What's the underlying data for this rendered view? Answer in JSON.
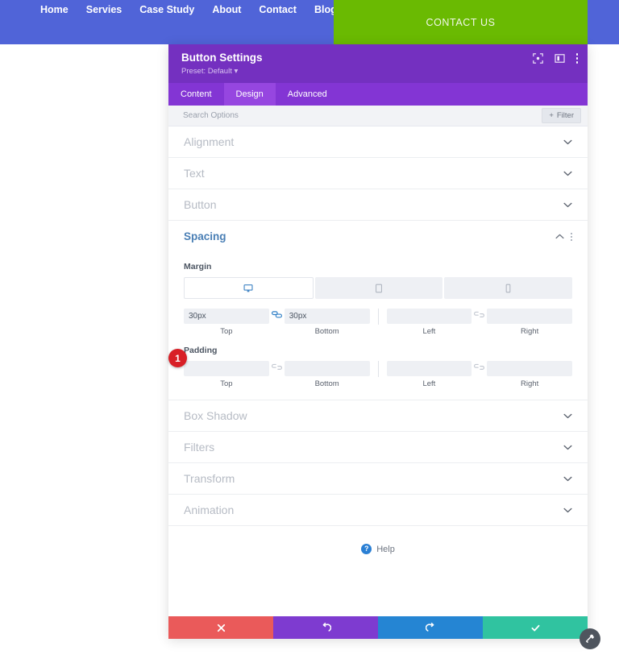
{
  "site_header": {
    "background_color": "#5064d8",
    "nav_items": [
      {
        "label": "Home"
      },
      {
        "label": "Servies"
      },
      {
        "label": "Case Study"
      },
      {
        "label": "About"
      },
      {
        "label": "Contact"
      },
      {
        "label": "Blog"
      }
    ],
    "cta": {
      "label": "CONTACT US",
      "background_color": "#6aba02"
    }
  },
  "modal": {
    "title": "Button Settings",
    "preset": "Preset: Default ▾",
    "header_color": "#7430c0",
    "icons": {
      "expand": "expand-icon",
      "layout": "layout-panel-icon",
      "menu": "kebab-menu-icon"
    },
    "tabs": [
      {
        "label": "Content",
        "active": false
      },
      {
        "label": "Design",
        "active": true
      },
      {
        "label": "Advanced",
        "active": false
      }
    ],
    "search": {
      "placeholder": "Search Options",
      "value": ""
    },
    "filter_button": {
      "label": "Filter",
      "plus": "+"
    },
    "sections": [
      {
        "label": "Alignment",
        "open": false
      },
      {
        "label": "Text",
        "open": false
      },
      {
        "label": "Button",
        "open": false
      },
      {
        "label": "Spacing",
        "open": true,
        "accent_color": "#4a7fb5"
      },
      {
        "label": "Box Shadow",
        "open": false
      },
      {
        "label": "Filters",
        "open": false
      },
      {
        "label": "Transform",
        "open": false
      },
      {
        "label": "Animation",
        "open": false
      }
    ],
    "spacing": {
      "device_tabs": [
        {
          "name": "desktop-icon",
          "active": true
        },
        {
          "name": "tablet-icon",
          "active": false
        },
        {
          "name": "phone-icon",
          "active": false
        }
      ],
      "margin": {
        "label": "Margin",
        "top": {
          "value": "30px",
          "caption": "Top"
        },
        "bottom": {
          "value": "30px",
          "caption": "Bottom"
        },
        "left": {
          "value": "",
          "caption": "Left"
        },
        "right": {
          "value": "",
          "caption": "Right"
        },
        "link_top_bottom": "linked",
        "link_left_right": "unlinked"
      },
      "padding": {
        "label": "Padding",
        "top": {
          "value": "",
          "caption": "Top"
        },
        "bottom": {
          "value": "",
          "caption": "Bottom"
        },
        "left": {
          "value": "",
          "caption": "Left"
        },
        "right": {
          "value": "",
          "caption": "Right"
        },
        "link_top_bottom": "unlinked",
        "link_left_right": "unlinked"
      }
    },
    "help": {
      "label": "Help",
      "icon_char": "?"
    },
    "footer_buttons": [
      {
        "name": "cancel-button",
        "icon": "close-icon",
        "color": "#ea5a5a"
      },
      {
        "name": "undo-button",
        "icon": "undo-icon",
        "color": "#7e3bd0"
      },
      {
        "name": "redo-button",
        "icon": "redo-icon",
        "color": "#2585d3"
      },
      {
        "name": "save-button",
        "icon": "check-icon",
        "color": "#30c3a0"
      }
    ]
  },
  "annotations": {
    "step_badge": "1"
  }
}
